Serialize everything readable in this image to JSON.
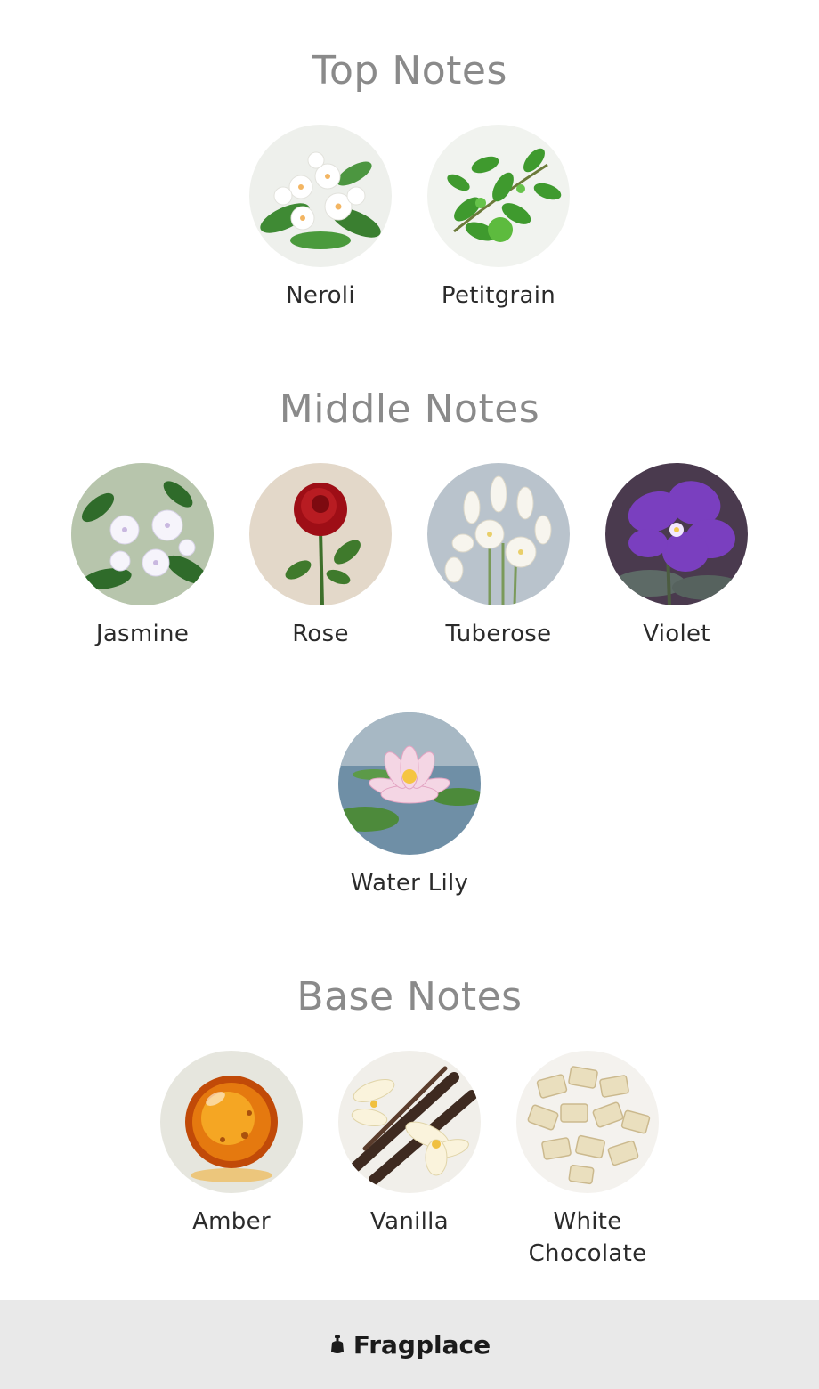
{
  "sections": {
    "top": {
      "title": "Top Notes",
      "notes": [
        "Neroli",
        "Petitgrain"
      ]
    },
    "middle": {
      "title": "Middle Notes",
      "notes": [
        "Jasmine",
        "Rose",
        "Tuberose",
        "Violet",
        "Water Lily"
      ]
    },
    "base": {
      "title": "Base Notes",
      "notes": [
        "Amber",
        "Vanilla",
        "White Chocolate"
      ]
    }
  },
  "footer": {
    "brand": "Fragplace",
    "logo_icon": "perfume-bottle-icon"
  },
  "colors": {
    "title": "#8a8a8a",
    "label": "#2b2b2b",
    "footer_bg": "#e9e9e9"
  }
}
